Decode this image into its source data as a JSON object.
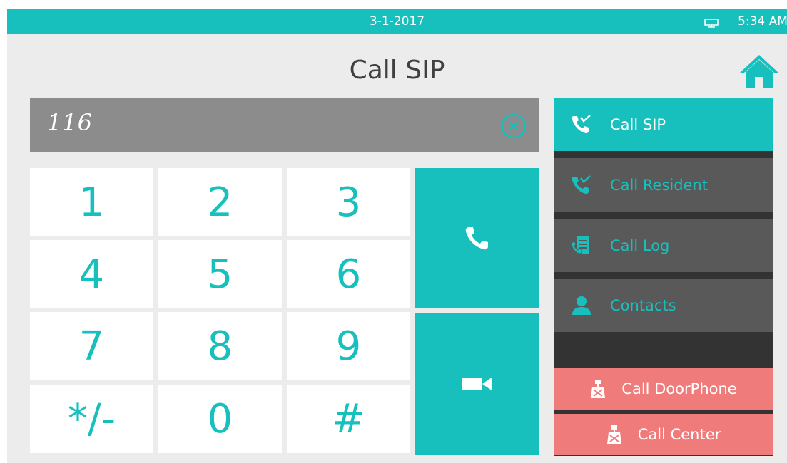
{
  "status_bar": {
    "date": "3-1-2017",
    "time": "5:34 AM",
    "status_icon": "monitor-icon"
  },
  "header": {
    "title": "Call SIP",
    "home_icon": "home-icon"
  },
  "display": {
    "number": "116",
    "clear_icon": "clear-circle-icon"
  },
  "keypad": {
    "keys": [
      "1",
      "2",
      "3",
      "4",
      "5",
      "6",
      "7",
      "8",
      "9",
      "*/-",
      "0",
      "#"
    ]
  },
  "actions": {
    "audio_call_icon": "phone-icon",
    "video_call_icon": "video-camera-icon"
  },
  "sidebar": {
    "items": [
      {
        "label": "Call SIP",
        "icon": "call-sip-icon",
        "active": true
      },
      {
        "label": "Call Resident",
        "icon": "call-resident-icon",
        "active": false
      },
      {
        "label": "Call Log",
        "icon": "call-log-icon",
        "active": false
      },
      {
        "label": "Contacts",
        "icon": "contacts-icon",
        "active": false
      }
    ],
    "bottom_items": [
      {
        "label": "Call DoorPhone",
        "icon": "doorphone-icon"
      },
      {
        "label": "Call Center",
        "icon": "call-center-icon"
      }
    ]
  },
  "colors": {
    "accent": "#17c0bd",
    "background": "#ececec",
    "display": "#8c8c8c",
    "sidebar_item": "#595959",
    "sidebar_bg": "#333333",
    "pink": "#f07b7b"
  }
}
